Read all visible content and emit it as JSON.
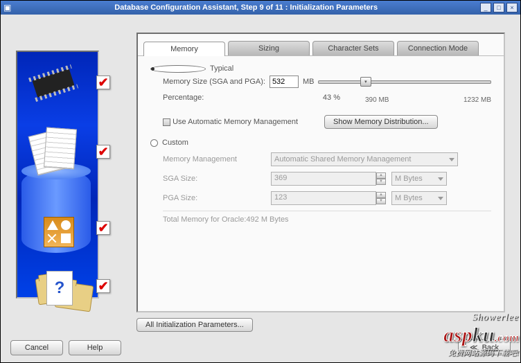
{
  "window": {
    "title": "Database Configuration Assistant, Step 9 of 11 : Initialization Parameters"
  },
  "tabs": {
    "memory": "Memory",
    "sizing": "Sizing",
    "charsets": "Character Sets",
    "connmode": "Connection Mode"
  },
  "typical": {
    "label": "Typical",
    "mem_label": "Memory Size (SGA and PGA):",
    "mem_value": "532",
    "mem_unit": "MB",
    "pct_label": "Percentage:",
    "pct_value": "43 %",
    "scale_lo": "390 MB",
    "scale_hi": "1232 MB",
    "amm_label": "Use Automatic Memory Management",
    "showdist": "Show Memory Distribution..."
  },
  "custom": {
    "label": "Custom",
    "mgmt_label": "Memory Management",
    "mgmt_value": "Automatic Shared Memory Management",
    "sga_label": "SGA Size:",
    "sga_value": "369",
    "sga_unit": "M Bytes",
    "pga_label": "PGA Size:",
    "pga_value": "123",
    "pga_unit": "M Bytes",
    "total_label": "Total Memory for Oracle:",
    "total_value": "492 M Bytes"
  },
  "buttons": {
    "all_params": "All Initialization Parameters...",
    "cancel": "Cancel",
    "help": "Help",
    "back": "Back",
    "back_glyph": "≪"
  },
  "watermark_top": "Showerlee",
  "watermark_big_a": "asp",
  "watermark_big_b": "ku",
  "watermark_tld": ".com",
  "watermark_sub": "免费网站源码下载吧!"
}
